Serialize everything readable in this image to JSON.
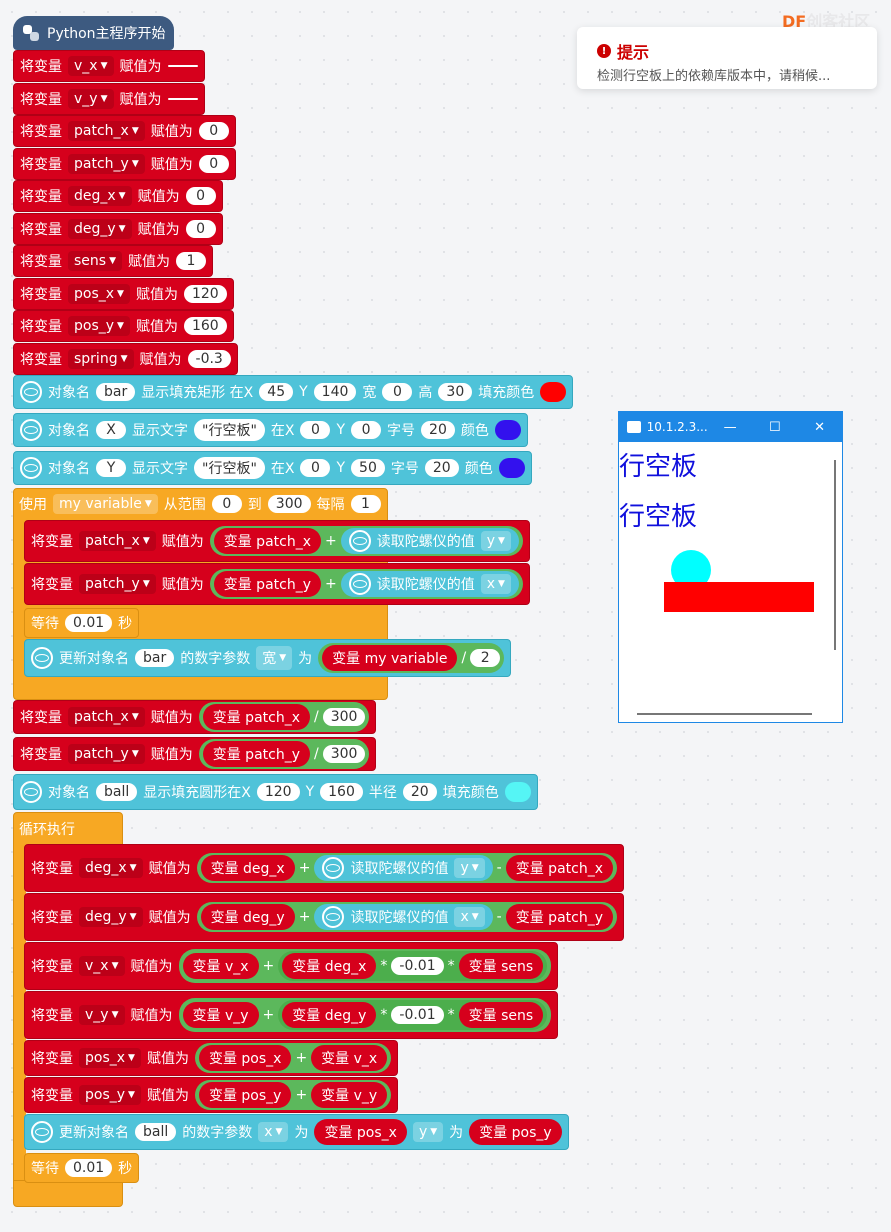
{
  "brand": {
    "df": "DF",
    "rest": "创客社区"
  },
  "tip": {
    "title": "提示",
    "message": "检测行空板上的依赖库版本中，请稍候..."
  },
  "window": {
    "title": "10.1.2.3...",
    "min": "—",
    "max": "☐",
    "close": "✕",
    "text1": "行空板",
    "text2": "行空板"
  },
  "hat": {
    "label": "Python主程序开始"
  },
  "kw": {
    "set": "将变量",
    "assign": "赋值为",
    "obj": "对象名",
    "var": "变量",
    "gyro": "读取陀螺仪的值",
    "wait": "等待",
    "sec": "秒",
    "update": "更新对象名",
    "numparam": "的数字参数",
    "to": "为",
    "use": "使用",
    "from_range": "从范围",
    "to2": "到",
    "step": "每隔",
    "loop": "循环执行",
    "plus": "+",
    "minus": "-",
    "times": "*",
    "div": "/"
  },
  "init_vars": [
    {
      "name": "v_x",
      "value": ""
    },
    {
      "name": "v_y",
      "value": ""
    },
    {
      "name": "patch_x",
      "value": "0"
    },
    {
      "name": "patch_y",
      "value": "0"
    },
    {
      "name": "deg_x",
      "value": "0"
    },
    {
      "name": "deg_y",
      "value": "0"
    },
    {
      "name": "sens",
      "value": "1"
    },
    {
      "name": "pos_x",
      "value": "120"
    },
    {
      "name": "pos_y",
      "value": "160"
    },
    {
      "name": "spring",
      "value": "-0.3"
    }
  ],
  "rect_block": {
    "obj": "bar",
    "label": "显示填充矩形 在X",
    "x": "45",
    "y": "140",
    "w_label": "宽",
    "w": "0",
    "h_label": "高",
    "h": "30",
    "fill_label": "填充颜色",
    "color": "#ff0000"
  },
  "text_x_block": {
    "obj": "X",
    "label": "显示文字",
    "text": "\"行空板\"",
    "at": "在X",
    "x": "0",
    "y": "0",
    "size_label": "字号",
    "size": "20",
    "color_label": "颜色",
    "color": "#3311ee"
  },
  "text_y_block": {
    "obj": "Y",
    "label": "显示文字",
    "text": "\"行空板\"",
    "at": "在X",
    "x": "0",
    "y": "50",
    "size_label": "字号",
    "size": "20",
    "color_label": "颜色",
    "color": "#3311ee"
  },
  "for_block": {
    "var": "my variable",
    "start": "0",
    "end": "300",
    "step": "1"
  },
  "for_body": {
    "patch_x": {
      "name": "patch_x",
      "var": "变量 patch_x",
      "axis": "y"
    },
    "patch_y": {
      "name": "patch_y",
      "var": "变量 patch_y",
      "axis": "x"
    },
    "wait": "0.01",
    "update": {
      "obj": "bar",
      "param": "宽",
      "var": "变量 my variable",
      "div": "2"
    }
  },
  "after_for": {
    "px": {
      "name": "patch_x",
      "var": "变量 patch_x",
      "div": "300"
    },
    "py": {
      "name": "patch_y",
      "var": "变量 patch_y",
      "div": "300"
    }
  },
  "circle_block": {
    "obj": "ball",
    "label": "显示填充圆形在X",
    "x": "120",
    "y": "160",
    "r_label": "半径",
    "r": "20",
    "fill_label": "填充颜色",
    "color": "#55f5f5"
  },
  "loop_body": {
    "dx": {
      "name": "deg_x",
      "a": "变量 deg_x",
      "axis": "y",
      "b": "变量 patch_x"
    },
    "dy": {
      "name": "deg_y",
      "a": "变量 deg_y",
      "axis": "x",
      "b": "变量 patch_y"
    },
    "vx": {
      "name": "v_x",
      "a": "变量 v_x",
      "b": "变量 deg_x",
      "k": "-0.01",
      "c": "变量 sens"
    },
    "vy": {
      "name": "v_y",
      "a": "变量 v_y",
      "b": "变量 deg_y",
      "k": "-0.01",
      "c": "变量 sens"
    },
    "px": {
      "name": "pos_x",
      "a": "变量 pos_x",
      "b": "变量 v_x"
    },
    "py": {
      "name": "pos_y",
      "a": "变量 pos_y",
      "b": "变量 v_y"
    },
    "upd": {
      "obj": "ball",
      "p1": "x",
      "v1": "变量 pos_x",
      "p2": "y",
      "v2": "变量 pos_y"
    },
    "wait": "0.01"
  }
}
